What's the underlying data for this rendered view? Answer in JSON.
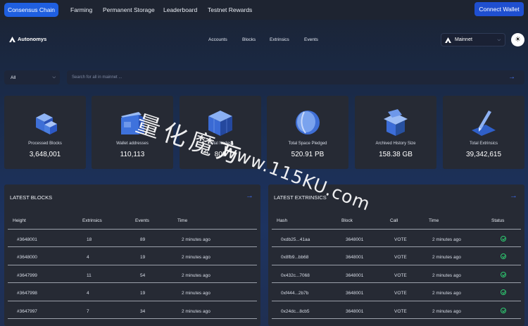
{
  "topnav": {
    "active": "Consensus Chain",
    "links": [
      "Farming",
      "Permanent Storage",
      "Leaderboard",
      "Testnet Rewards"
    ],
    "connect": "Connect Wallet"
  },
  "header": {
    "logo": "Autonomys",
    "nav": [
      "Accounts",
      "Blocks",
      "Extrinsics",
      "Events"
    ],
    "network": "Mainnet"
  },
  "search": {
    "filter": "All",
    "placeholder": "Search for all in mainnet ..."
  },
  "stats": [
    {
      "label": "Processed Blocks",
      "value": "3,648,001",
      "icon": "blocks-cube-icon"
    },
    {
      "label": "Wallet addresses",
      "value": "110,113",
      "icon": "wallet-icon"
    },
    {
      "label": "Total Nodes",
      "value": "809",
      "icon": "nodes-cube-icon"
    },
    {
      "label": "Total Space Pledged",
      "value": "520.91 PB",
      "icon": "disk-icon"
    },
    {
      "label": "Archived History Size",
      "value": "158.38 GB",
      "icon": "archive-box-icon"
    },
    {
      "label": "Total Extrinsics",
      "value": "39,342,615",
      "icon": "pen-icon"
    }
  ],
  "latest_blocks": {
    "title": "LATEST BLOCKS",
    "columns": [
      "Height",
      "Extrinsics",
      "Events",
      "Time"
    ],
    "rows": [
      [
        "#3648001",
        "18",
        "89",
        "2 minutes ago"
      ],
      [
        "#3648000",
        "4",
        "19",
        "2 minutes ago"
      ],
      [
        "#3647999",
        "11",
        "54",
        "2 minutes ago"
      ],
      [
        "#3647998",
        "4",
        "19",
        "2 minutes ago"
      ],
      [
        "#3647997",
        "7",
        "34",
        "2 minutes ago"
      ]
    ]
  },
  "latest_extrinsics": {
    "title": "LATEST EXTRINSICS",
    "columns": [
      "Hash",
      "Block",
      "Call",
      "Time",
      "Status"
    ],
    "rows": [
      [
        "0xdb25...41aa",
        "3648001",
        "VOTE",
        "2 minutes ago"
      ],
      [
        "0x8fb9...bb68",
        "3648001",
        "VOTE",
        "2 minutes ago"
      ],
      [
        "0x432c...7068",
        "3648001",
        "VOTE",
        "2 minutes ago"
      ],
      [
        "0xf444...2b7b",
        "3648001",
        "VOTE",
        "2 minutes ago"
      ],
      [
        "0x24dc...8cb5",
        "3648001",
        "VOTE",
        "2 minutes ago"
      ]
    ]
  },
  "watermark": {
    "cn": "量化魔方",
    "url": "www.115KU.com"
  },
  "colors": {
    "accent": "#1f5fe0",
    "success": "#2ecc71",
    "panel": "#262a34"
  }
}
